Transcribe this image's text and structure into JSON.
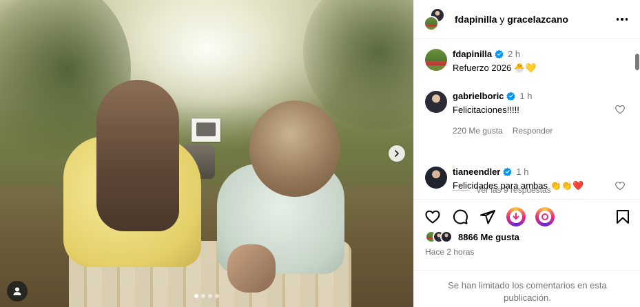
{
  "post": {
    "header": {
      "user1": "fdapinilla",
      "joiner": "y",
      "user2": "gracelazcano"
    },
    "caption": {
      "username": "fdapinilla",
      "time": "2 h",
      "text": "Refuerzo 2026 🐣💛"
    },
    "comments": [
      {
        "username": "gabrielboric",
        "time": "1 h",
        "text": "Felicitaciones!!!!!",
        "likes": "220 Me gusta",
        "reply_label": "Responder"
      },
      {
        "username": "tianeendler",
        "time": "1 h",
        "text": "Felicidades para ambas 👏👏❤️"
      }
    ],
    "view_replies": "Ver las 9 respuestas",
    "likes_count": "8866 Me gusta",
    "posted_ago": "Hace 2 horas",
    "comments_limited": "Se han limitado los comentarios en esta publicación."
  },
  "carousel": {
    "slide_count": 4,
    "active_index": 0
  },
  "icons": {
    "more": "more-horizontal-icon",
    "verified": "verified-badge-icon",
    "like": "heart-icon",
    "comment": "comment-icon",
    "share": "share-icon",
    "gift": "gift-icon",
    "remix": "remix-icon",
    "save": "bookmark-icon",
    "next": "chevron-right-icon",
    "tags": "user-tag-icon"
  },
  "colors": {
    "verified": "#0095f6",
    "muted_text": "#737373",
    "divider": "#efefef",
    "gift_gradient": [
      "#f9ce34",
      "#ee2a7b",
      "#6228d7"
    ]
  }
}
